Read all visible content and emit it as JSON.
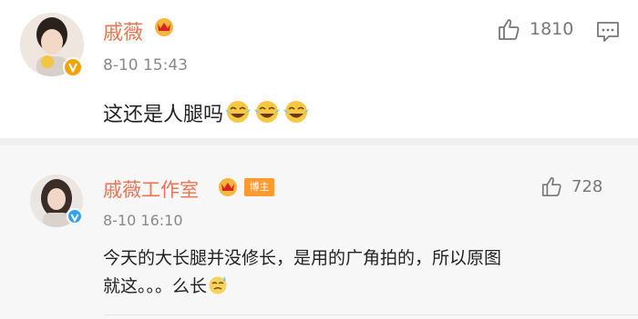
{
  "comments": [
    {
      "username": "戚薇",
      "time": "8-10 15:43",
      "text": "这还是人腿吗",
      "likes": "1810",
      "verified": "orange-v-icon"
    },
    {
      "username": "戚薇工作室",
      "badge": "博主",
      "time": "8-10 16:10",
      "text_line1": "今天的大长腿并没修长，是用的广角拍的，所以原图",
      "text_line2": "就这。。。么长",
      "likes": "728",
      "verified": "blue-v-icon"
    }
  ],
  "colors": {
    "username": "#eb7350",
    "badge": "#ff9a2e",
    "meta": "#888888"
  }
}
